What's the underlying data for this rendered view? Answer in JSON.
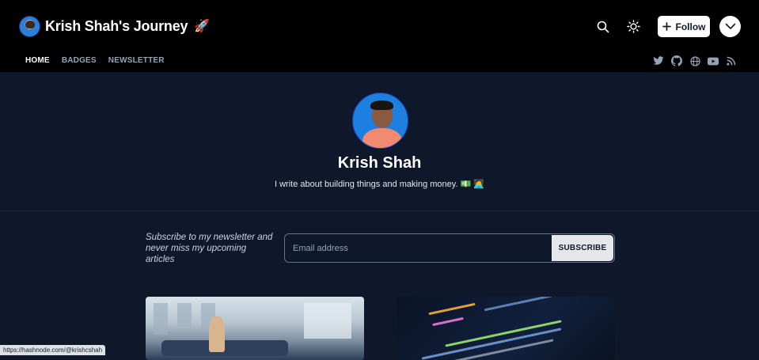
{
  "header": {
    "title": "Krish Shah's Journey",
    "title_emoji": "🚀",
    "follow_label": "Follow"
  },
  "nav": {
    "items": [
      {
        "label": "HOME",
        "active": true
      },
      {
        "label": "BADGES",
        "active": false
      },
      {
        "label": "NEWSLETTER",
        "active": false
      }
    ]
  },
  "socials": [
    "twitter-icon",
    "github-icon",
    "globe-icon",
    "youtube-icon",
    "rss-icon"
  ],
  "profile": {
    "name": "Krish Shah",
    "bio": "I write about building things and making money. 💵 🧑‍💻"
  },
  "newsletter": {
    "prompt": "Subscribe to my newsletter and never miss my upcoming articles",
    "email_placeholder": "Email address",
    "subscribe_label": "SUBSCRIBE"
  },
  "status_bar": {
    "url": "https://hashnode.com/@krishcshah"
  },
  "colors": {
    "header_bg": "#000000",
    "page_bg": "#0f172a",
    "accent_white": "#ffffff"
  }
}
